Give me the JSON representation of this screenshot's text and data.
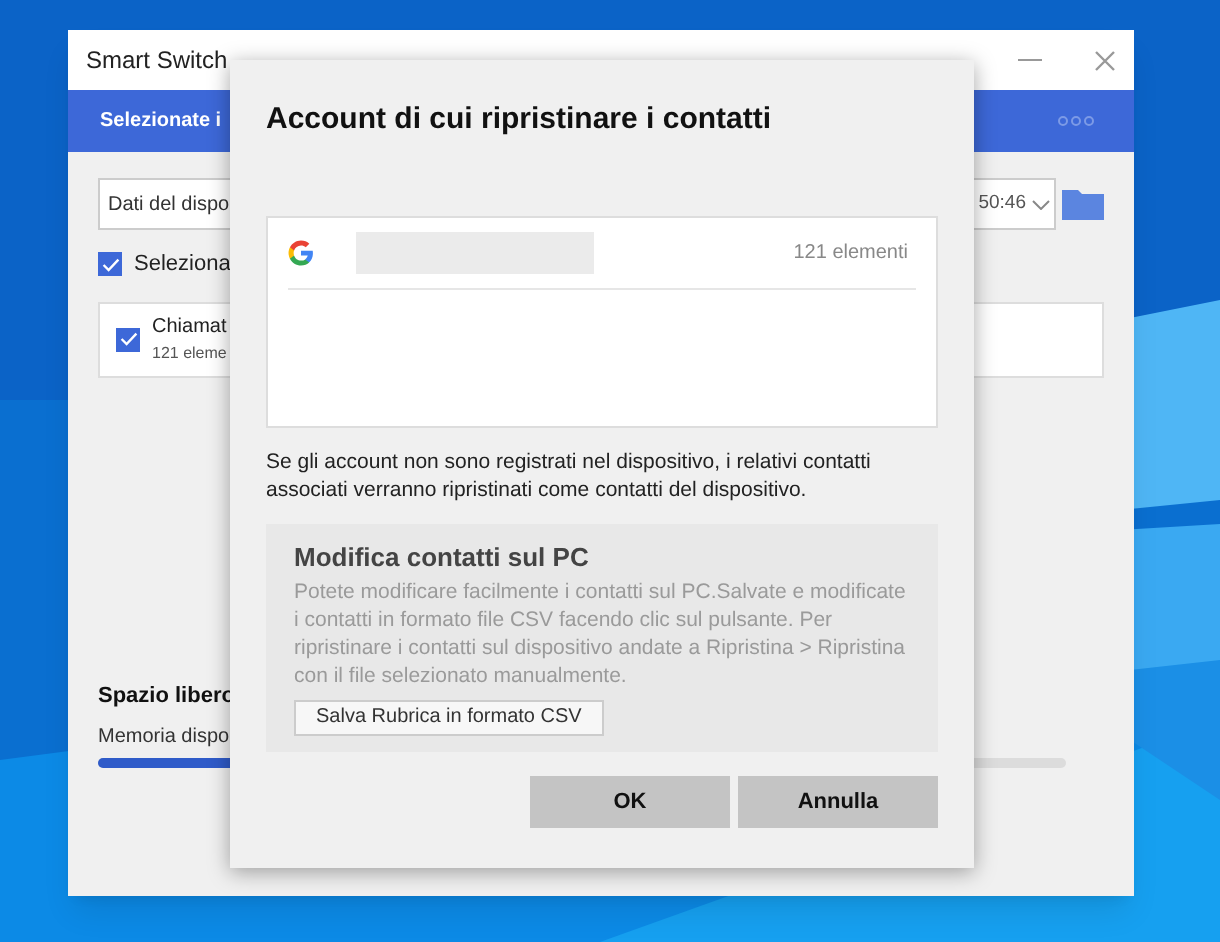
{
  "window": {
    "title": "Smart Switch"
  },
  "header": {
    "title": "Selezionate i"
  },
  "backup_dropdown": {
    "value_start": "Dati del dispo",
    "value_end": "50:46"
  },
  "select_all": {
    "label": "Seleziona",
    "checked": true
  },
  "items": [
    {
      "name": "Chiamat",
      "count": "121 eleme",
      "checked": true
    }
  ],
  "storage": {
    "title": "Spazio libero",
    "subtitle": "Memoria dispo",
    "level": 0.3
  },
  "dialog": {
    "title": "Account di cui ripristinare i contatti",
    "accounts": [
      {
        "count": "121 elementi"
      }
    ],
    "note": "Se gli account non sono registrati nel dispositivo, i relativi contatti associati verranno ripristinati come contatti del dispositivo.",
    "section": {
      "title": "Modifica contatti sul PC",
      "body": "Potete modificare facilmente i contatti sul PC.Salvate e modificate i contatti in formato file CSV facendo clic sul pulsante. Per ripristinare i contatti sul dispositivo andate a Ripristina > Ripristina con il file selezionato manualmente.",
      "button": "Salva Rubrica in formato CSV"
    },
    "buttons": [
      "OK",
      "Annulla"
    ]
  }
}
